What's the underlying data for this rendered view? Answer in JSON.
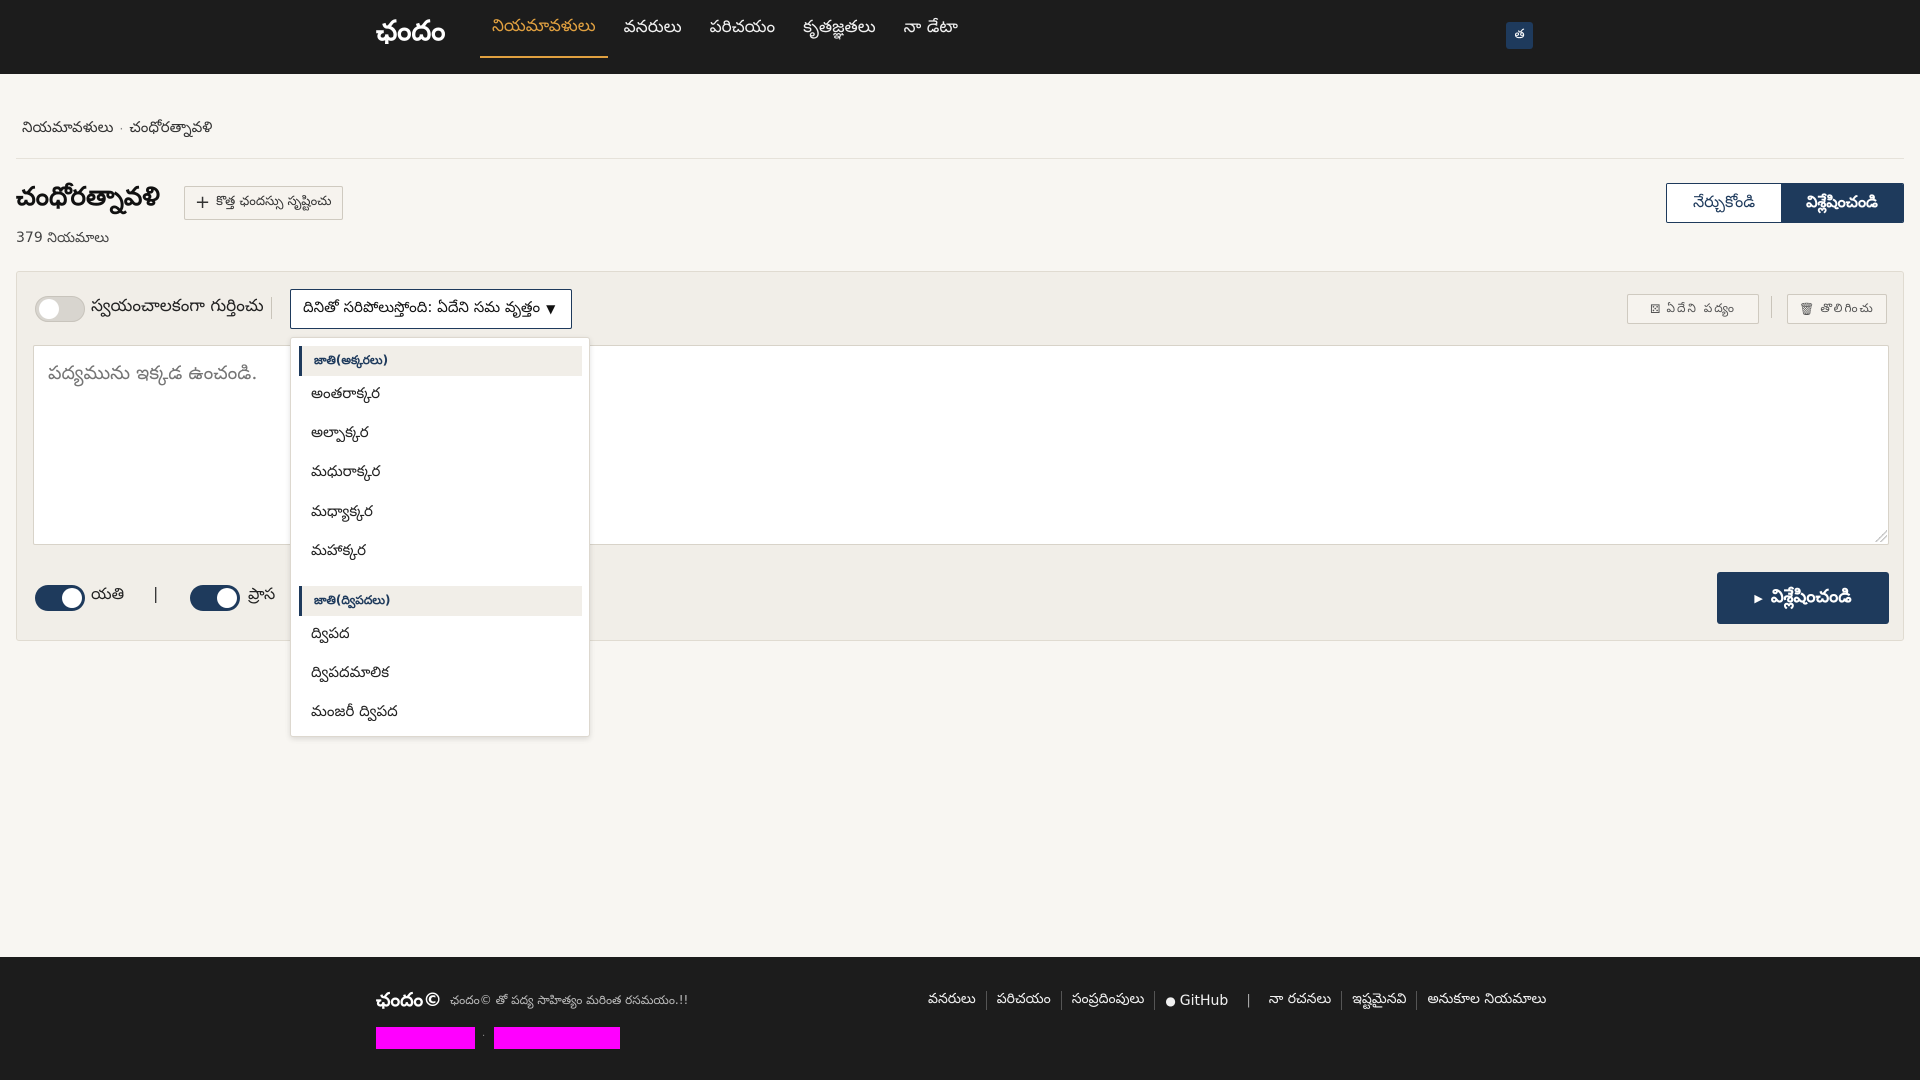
{
  "header": {
    "brand": "ఛందం",
    "nav": [
      "నియమావళులు",
      "వనరులు",
      "పరిచయం",
      "కృతజ్ఞతలు",
      "నా డేటా"
    ],
    "active_nav": 0,
    "lang_button": "త"
  },
  "breadcrumb": {
    "root": "నియమావళులు",
    "current": "చంధోరత్నావళి"
  },
  "page": {
    "title": "చంధోరత్నావళి",
    "create_label": "కొత్త ఛందస్సు సృష్టించు",
    "rule_count": "379 నియమాలు",
    "mode_learn": "నేర్చుకోండి",
    "mode_analyse": "విశ్లేషించండి"
  },
  "panel": {
    "auto_detect_label": "స్వయంచాలకంగా గుర్తించు",
    "auto_detect_on": false,
    "meter_select_value": "దినితో సరిపోలుస్తోంది: ఏదేని సమ వృత్తం",
    "sample_button": "ఏదేని పద్యం",
    "clear_button": "తొలిగించు",
    "poem_placeholder": "పద్యమును ఇక్కడ ఉంచండి.",
    "yati_label": "యతి",
    "yati_on": true,
    "separator": "|",
    "prasa_label": "ప్రాస",
    "prasa_on": true,
    "analyse_button": "విశ్లేషించండి"
  },
  "dropdown": {
    "groups": [
      {
        "label": "జాతి(అక్కరలు)",
        "items": [
          "అంతరాక్కర",
          "అల్పాక్కర",
          "మధురాక్కర",
          "మధ్యాక్కర",
          "మహాక్కర"
        ]
      },
      {
        "label": "జాతి(ద్విపదలు)",
        "items": [
          "ద్విపద",
          "ద్విపదమాలిక",
          "మంజరీ ద్విపద"
        ]
      }
    ]
  },
  "footer": {
    "brand": "ఛందం©",
    "tagline": "ఛందం© తో పద్య సాహిత్యం మరింత రసమయం.!!",
    "links": [
      "వనరులు",
      "పరిచయం",
      "సంప్రదింపులు",
      "GitHub"
    ],
    "separator": "|",
    "links2": [
      "నా రచనలు",
      "ఇష్టమైనవి",
      "అనుకూల నియమాలు"
    ]
  },
  "colors": {
    "primary": "#1e3a5c",
    "accent": "#e0a040",
    "header_bg": "#1c1c1c",
    "page_bg": "#f8f6f2",
    "redaction": "#ff00ff"
  }
}
